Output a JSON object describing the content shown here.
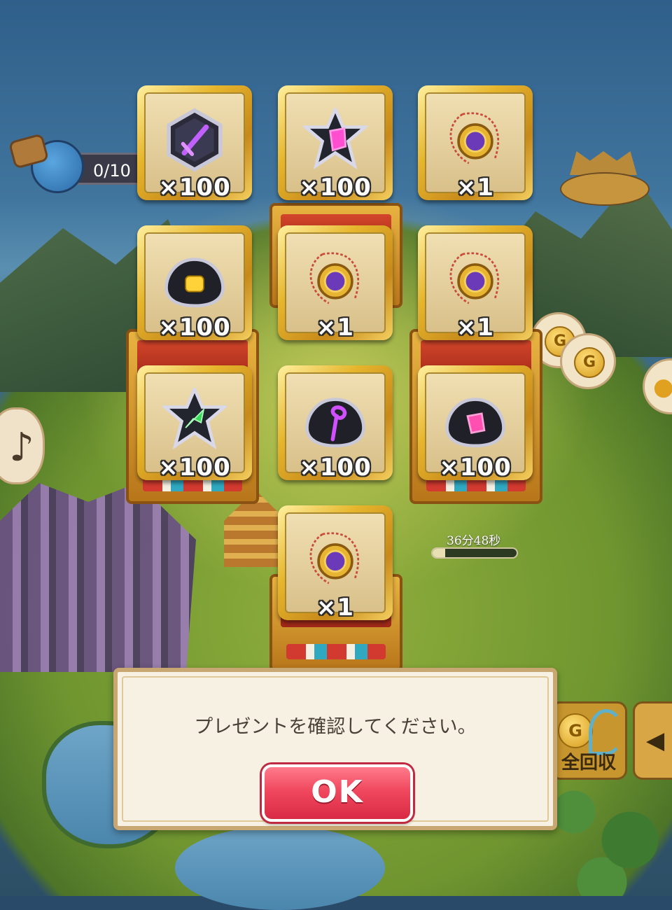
{
  "hud": {
    "progress_counter": "0/10",
    "timer_text": "36分48秒",
    "timer_fill_fraction": 0.15,
    "collect_all_label": "全回収",
    "coin_letter": "G"
  },
  "rewards": [
    {
      "item": "black-hexagon-crystal-sword-icon",
      "quantity": "×100"
    },
    {
      "item": "black-star-crystal-pink-gem-icon",
      "quantity": "×100"
    },
    {
      "item": "golden-amulet-necklace-icon",
      "quantity": "×1"
    },
    {
      "item": "black-slime-orb-yellow-fist-icon",
      "quantity": "×100"
    },
    {
      "item": "golden-amulet-necklace-icon",
      "quantity": "×1"
    },
    {
      "item": "golden-amulet-necklace-icon",
      "quantity": "×1"
    },
    {
      "item": "black-star-crystal-green-arrow-icon",
      "quantity": "×100"
    },
    {
      "item": "black-slime-orb-purple-staff-icon",
      "quantity": "×100"
    },
    {
      "item": "black-slime-orb-pink-gem-icon",
      "quantity": "×100"
    },
    {
      "item": "golden-amulet-necklace-icon",
      "quantity": "×1"
    }
  ],
  "dialog": {
    "message": "プレゼントを確認してください。",
    "ok_label": "OK"
  },
  "colors": {
    "ok_button": "#f0485e",
    "tile_gold": "#e6b52c",
    "dialog_bg": "#f7f1e3"
  }
}
